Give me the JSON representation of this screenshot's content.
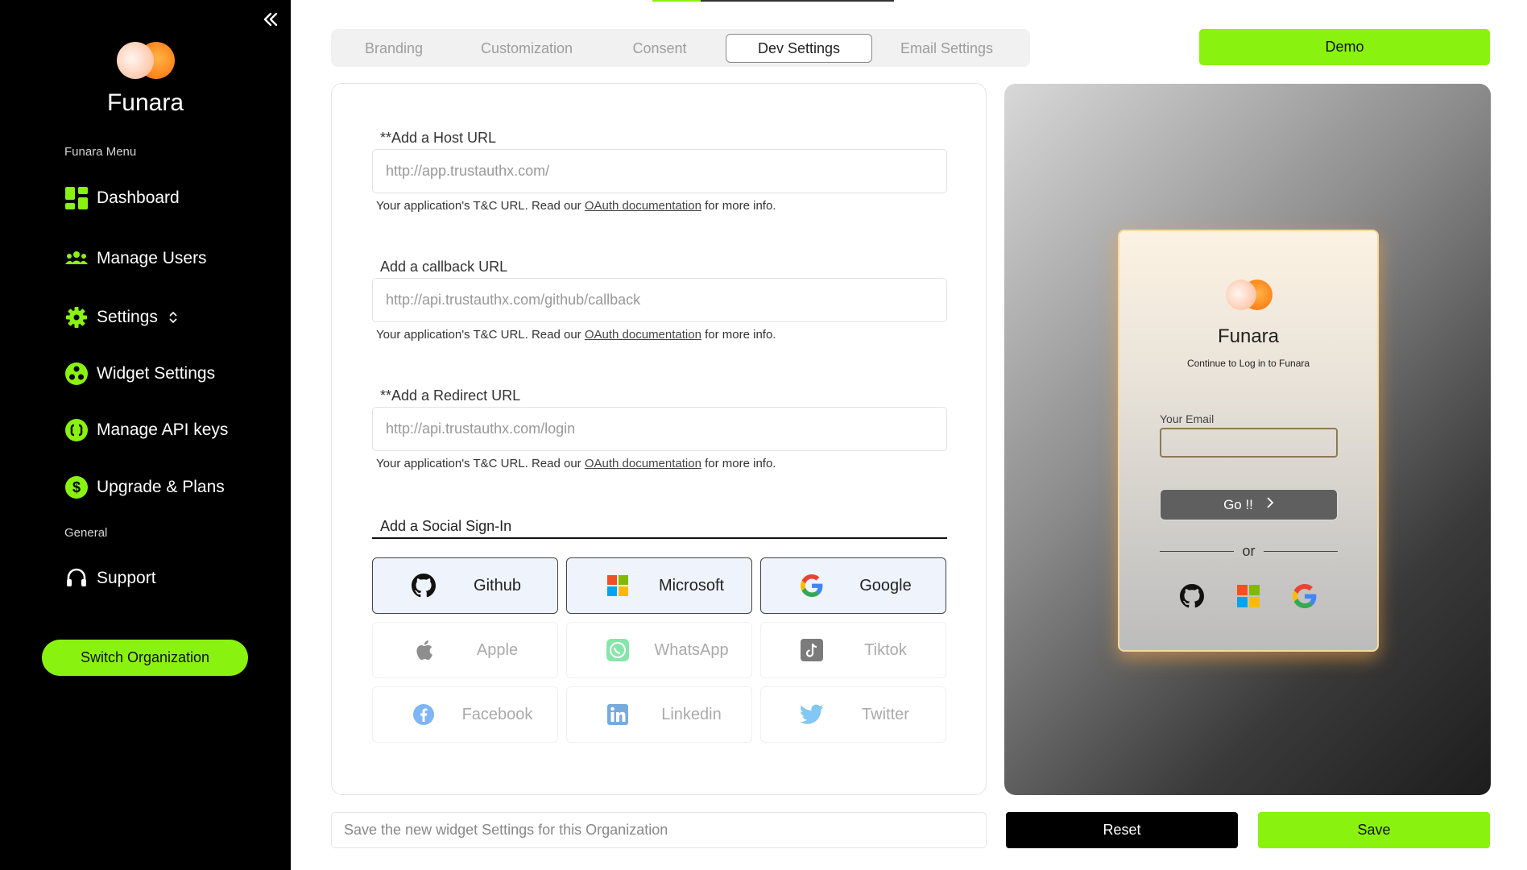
{
  "colors": {
    "accent": "#8af20f",
    "sidebar_bg": "#000000",
    "logo_left": "#ffe3d6",
    "logo_right": "#ff8a1c"
  },
  "sidebar": {
    "brand": "Funara",
    "menu_heading": "Funara Menu",
    "items": [
      {
        "label": "Dashboard",
        "icon": "dashboard-icon"
      },
      {
        "label": "Manage Users",
        "icon": "users-icon"
      },
      {
        "label": "Settings",
        "icon": "gear-icon"
      },
      {
        "label": "Widget Settings",
        "icon": "widget-icon"
      },
      {
        "label": "Manage API keys",
        "icon": "api-key-icon"
      },
      {
        "label": "Upgrade & Plans",
        "icon": "dollar-icon"
      }
    ],
    "general_heading": "General",
    "support_label": "Support",
    "switch_org_label": "Switch Organization"
  },
  "tabs": [
    {
      "label": "Branding",
      "active": false
    },
    {
      "label": "Customization",
      "active": false
    },
    {
      "label": "Consent",
      "active": false
    },
    {
      "label": "Dev Settings",
      "active": true
    },
    {
      "label": "Email Settings",
      "active": false
    }
  ],
  "demo_label": "Demo",
  "form": {
    "fields": [
      {
        "label": "**Add a Host URL",
        "placeholder": "http://app.trustauthx.com/",
        "help_prefix": "Your application's T&C URL. Read our ",
        "help_link": "OAuth documentation",
        "help_suffix": " for more info."
      },
      {
        "label": "Add a callback URL",
        "placeholder": "http://api.trustauthx.com/github/callback",
        "help_prefix": "Your application's T&C URL. Read our ",
        "help_link": "OAuth documentation",
        "help_suffix": " for more info."
      },
      {
        "label": "**Add a Redirect URL",
        "placeholder": "http://api.trustauthx.com/login",
        "help_prefix": "Your application's T&C URL. Read our ",
        "help_link": "OAuth documentation",
        "help_suffix": " for more info."
      }
    ],
    "social_heading": "Add a Social Sign-In",
    "socials": [
      {
        "label": "Github",
        "icon": "github-icon",
        "enabled": true
      },
      {
        "label": "Microsoft",
        "icon": "microsoft-icon",
        "enabled": true
      },
      {
        "label": "Google",
        "icon": "google-icon",
        "enabled": true
      },
      {
        "label": "Apple",
        "icon": "apple-icon",
        "enabled": false
      },
      {
        "label": "WhatsApp",
        "icon": "whatsapp-icon",
        "enabled": false
      },
      {
        "label": "Tiktok",
        "icon": "tiktok-icon",
        "enabled": false
      },
      {
        "label": "Facebook",
        "icon": "facebook-icon",
        "enabled": false
      },
      {
        "label": "Linkedin",
        "icon": "linkedin-icon",
        "enabled": false
      },
      {
        "label": "Twitter",
        "icon": "twitter-icon",
        "enabled": false
      }
    ]
  },
  "preview": {
    "title": "Funara",
    "subtitle": "Continue to Log in to Funara",
    "email_label": "Your Email",
    "go_label": "Go !!",
    "or_label": "or",
    "social_icons": [
      "github-icon",
      "microsoft-icon",
      "google-icon"
    ]
  },
  "footer": {
    "save_note": "Save the new widget Settings for this Organization",
    "reset_label": "Reset",
    "save_label": "Save"
  }
}
